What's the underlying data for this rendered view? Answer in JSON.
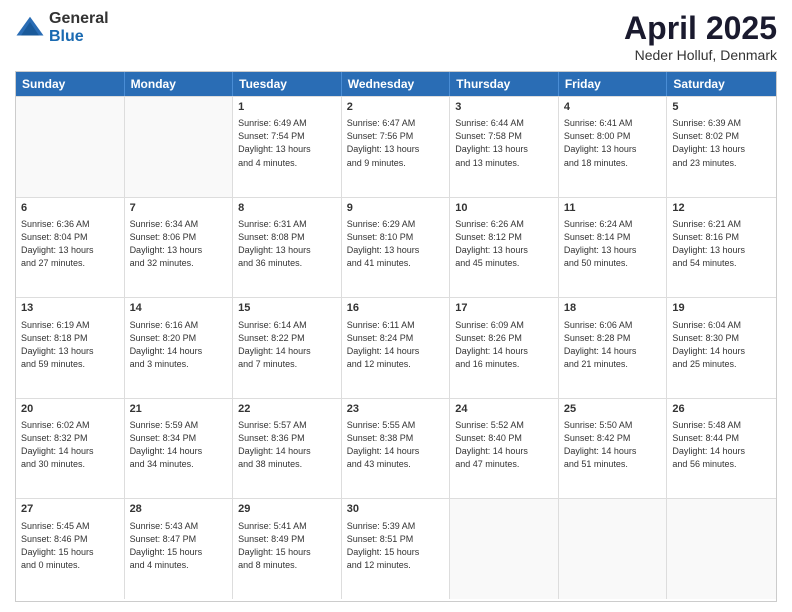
{
  "logo": {
    "general": "General",
    "blue": "Blue"
  },
  "title": "April 2025",
  "subtitle": "Neder Holluf, Denmark",
  "days": [
    "Sunday",
    "Monday",
    "Tuesday",
    "Wednesday",
    "Thursday",
    "Friday",
    "Saturday"
  ],
  "weeks": [
    [
      {
        "day": "",
        "content": ""
      },
      {
        "day": "",
        "content": ""
      },
      {
        "day": "1",
        "content": "Sunrise: 6:49 AM\nSunset: 7:54 PM\nDaylight: 13 hours\nand 4 minutes."
      },
      {
        "day": "2",
        "content": "Sunrise: 6:47 AM\nSunset: 7:56 PM\nDaylight: 13 hours\nand 9 minutes."
      },
      {
        "day": "3",
        "content": "Sunrise: 6:44 AM\nSunset: 7:58 PM\nDaylight: 13 hours\nand 13 minutes."
      },
      {
        "day": "4",
        "content": "Sunrise: 6:41 AM\nSunset: 8:00 PM\nDaylight: 13 hours\nand 18 minutes."
      },
      {
        "day": "5",
        "content": "Sunrise: 6:39 AM\nSunset: 8:02 PM\nDaylight: 13 hours\nand 23 minutes."
      }
    ],
    [
      {
        "day": "6",
        "content": "Sunrise: 6:36 AM\nSunset: 8:04 PM\nDaylight: 13 hours\nand 27 minutes."
      },
      {
        "day": "7",
        "content": "Sunrise: 6:34 AM\nSunset: 8:06 PM\nDaylight: 13 hours\nand 32 minutes."
      },
      {
        "day": "8",
        "content": "Sunrise: 6:31 AM\nSunset: 8:08 PM\nDaylight: 13 hours\nand 36 minutes."
      },
      {
        "day": "9",
        "content": "Sunrise: 6:29 AM\nSunset: 8:10 PM\nDaylight: 13 hours\nand 41 minutes."
      },
      {
        "day": "10",
        "content": "Sunrise: 6:26 AM\nSunset: 8:12 PM\nDaylight: 13 hours\nand 45 minutes."
      },
      {
        "day": "11",
        "content": "Sunrise: 6:24 AM\nSunset: 8:14 PM\nDaylight: 13 hours\nand 50 minutes."
      },
      {
        "day": "12",
        "content": "Sunrise: 6:21 AM\nSunset: 8:16 PM\nDaylight: 13 hours\nand 54 minutes."
      }
    ],
    [
      {
        "day": "13",
        "content": "Sunrise: 6:19 AM\nSunset: 8:18 PM\nDaylight: 13 hours\nand 59 minutes."
      },
      {
        "day": "14",
        "content": "Sunrise: 6:16 AM\nSunset: 8:20 PM\nDaylight: 14 hours\nand 3 minutes."
      },
      {
        "day": "15",
        "content": "Sunrise: 6:14 AM\nSunset: 8:22 PM\nDaylight: 14 hours\nand 7 minutes."
      },
      {
        "day": "16",
        "content": "Sunrise: 6:11 AM\nSunset: 8:24 PM\nDaylight: 14 hours\nand 12 minutes."
      },
      {
        "day": "17",
        "content": "Sunrise: 6:09 AM\nSunset: 8:26 PM\nDaylight: 14 hours\nand 16 minutes."
      },
      {
        "day": "18",
        "content": "Sunrise: 6:06 AM\nSunset: 8:28 PM\nDaylight: 14 hours\nand 21 minutes."
      },
      {
        "day": "19",
        "content": "Sunrise: 6:04 AM\nSunset: 8:30 PM\nDaylight: 14 hours\nand 25 minutes."
      }
    ],
    [
      {
        "day": "20",
        "content": "Sunrise: 6:02 AM\nSunset: 8:32 PM\nDaylight: 14 hours\nand 30 minutes."
      },
      {
        "day": "21",
        "content": "Sunrise: 5:59 AM\nSunset: 8:34 PM\nDaylight: 14 hours\nand 34 minutes."
      },
      {
        "day": "22",
        "content": "Sunrise: 5:57 AM\nSunset: 8:36 PM\nDaylight: 14 hours\nand 38 minutes."
      },
      {
        "day": "23",
        "content": "Sunrise: 5:55 AM\nSunset: 8:38 PM\nDaylight: 14 hours\nand 43 minutes."
      },
      {
        "day": "24",
        "content": "Sunrise: 5:52 AM\nSunset: 8:40 PM\nDaylight: 14 hours\nand 47 minutes."
      },
      {
        "day": "25",
        "content": "Sunrise: 5:50 AM\nSunset: 8:42 PM\nDaylight: 14 hours\nand 51 minutes."
      },
      {
        "day": "26",
        "content": "Sunrise: 5:48 AM\nSunset: 8:44 PM\nDaylight: 14 hours\nand 56 minutes."
      }
    ],
    [
      {
        "day": "27",
        "content": "Sunrise: 5:45 AM\nSunset: 8:46 PM\nDaylight: 15 hours\nand 0 minutes."
      },
      {
        "day": "28",
        "content": "Sunrise: 5:43 AM\nSunset: 8:47 PM\nDaylight: 15 hours\nand 4 minutes."
      },
      {
        "day": "29",
        "content": "Sunrise: 5:41 AM\nSunset: 8:49 PM\nDaylight: 15 hours\nand 8 minutes."
      },
      {
        "day": "30",
        "content": "Sunrise: 5:39 AM\nSunset: 8:51 PM\nDaylight: 15 hours\nand 12 minutes."
      },
      {
        "day": "",
        "content": ""
      },
      {
        "day": "",
        "content": ""
      },
      {
        "day": "",
        "content": ""
      }
    ]
  ]
}
